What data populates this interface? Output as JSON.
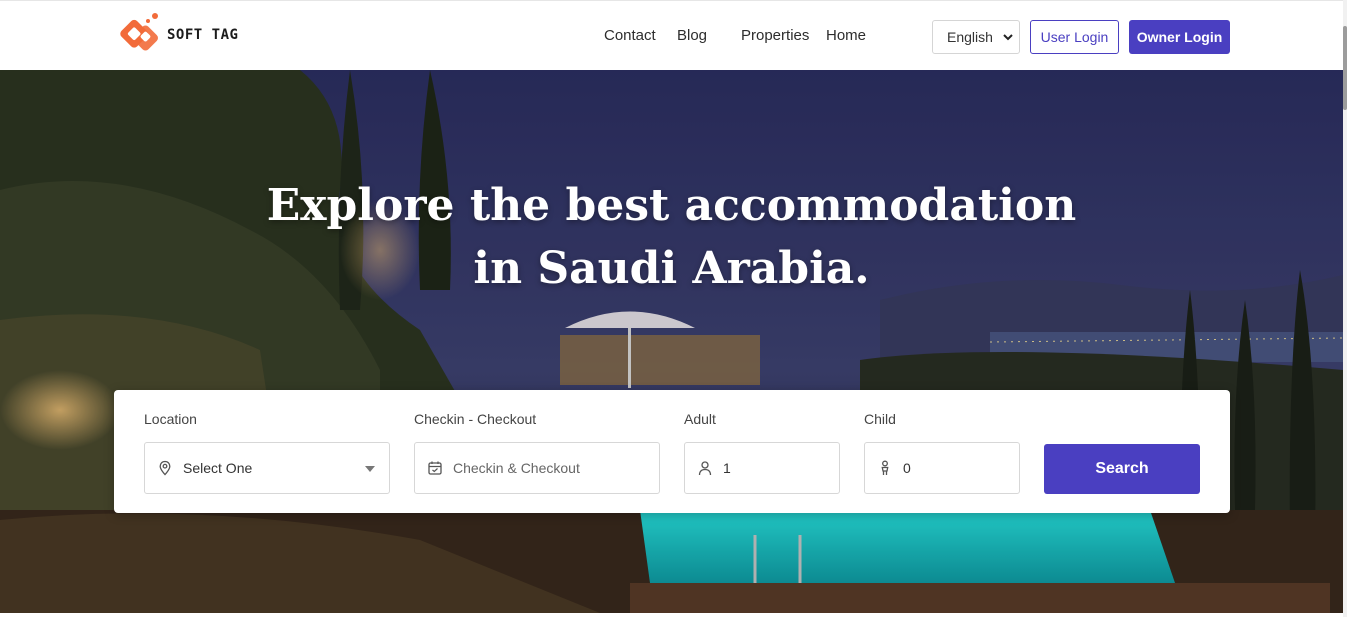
{
  "brand": {
    "name": "SOFT TAG",
    "accent": "#f26b3a"
  },
  "nav": {
    "contact": "Contact",
    "blog": "Blog",
    "properties": "Properties",
    "home": "Home"
  },
  "language": {
    "selected": "English"
  },
  "auth": {
    "user_login": "User Login",
    "owner_login": "Owner Login"
  },
  "colors": {
    "primary": "#4a3fc1",
    "brand_orange": "#f26b3a"
  },
  "hero": {
    "title_line1": "Explore the best accommodation",
    "title_line2": "in Saudi Arabia."
  },
  "search": {
    "location": {
      "label": "Location",
      "value": "Select One",
      "icon": "map-pin-icon"
    },
    "dates": {
      "label": "Checkin - Checkout",
      "placeholder": "Checkin & Checkout",
      "icon": "calendar-icon"
    },
    "adult": {
      "label": "Adult",
      "value": "1",
      "icon": "user-icon"
    },
    "child": {
      "label": "Child",
      "value": "0",
      "icon": "child-icon"
    },
    "button": "Search"
  }
}
